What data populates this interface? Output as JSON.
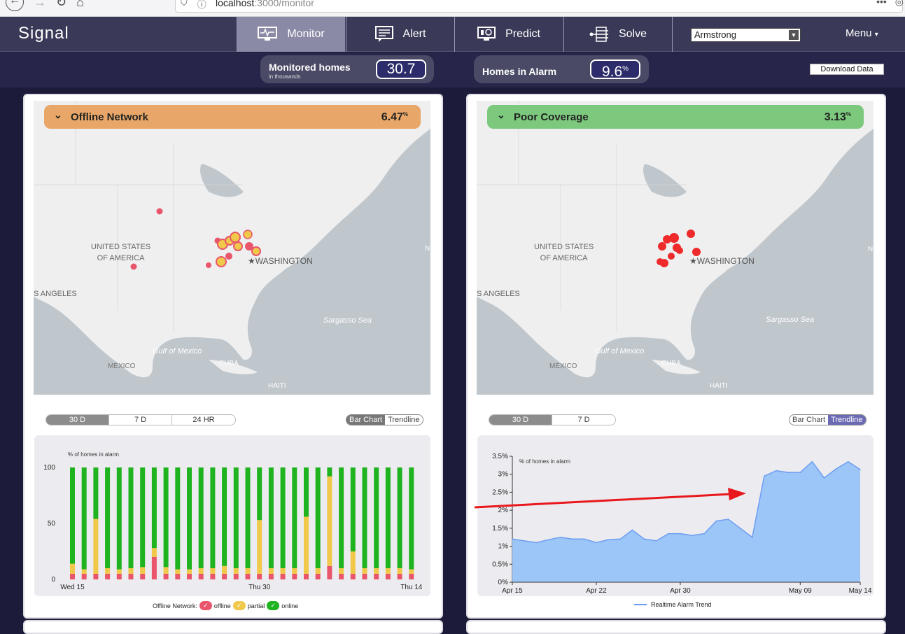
{
  "browser": {
    "url_host": "localhost",
    "url_path": ":3000/monitor"
  },
  "app": {
    "title": "Signal"
  },
  "nav": {
    "tabs": [
      {
        "label": "Monitor",
        "icon": "monitor-icon",
        "active": true
      },
      {
        "label": "Alert",
        "icon": "alert-icon",
        "active": false
      },
      {
        "label": "Predict",
        "icon": "predict-icon",
        "active": false
      },
      {
        "label": "Solve",
        "icon": "solve-icon",
        "active": false
      }
    ],
    "select_value": "Armstrong",
    "menu_label": "Menu"
  },
  "stats": {
    "monitored_label": "Monitored homes",
    "monitored_sub": "in thousands",
    "monitored_value": "30.7",
    "alarm_label": "Homes in Alarm",
    "alarm_value": "9.6",
    "alarm_unit": "%",
    "download_label": "Download Data"
  },
  "colors": {
    "offline_banner": "#e8a768",
    "coverage_banner": "#7cc97e",
    "bar_online": "#1fb31f",
    "bar_partial": "#f0c84a",
    "bar_offline": "#e9566b",
    "trend_fill": "#9cc6f7",
    "trend_line": "#6d9df2",
    "annotation_arrow": "#e8181c"
  },
  "map_labels": {
    "us": [
      "UNITED STATES",
      "OF AMERICA"
    ],
    "washington": "WASHINGTON",
    "los_angeles": "S ANGELES",
    "sargasso": "Sargasso Sea",
    "gulf": "Gulf of Mexico",
    "mexico": "MÉXICO",
    "cuba": "CUBA",
    "haiti": "HAITI",
    "edge": "N"
  },
  "card_offline": {
    "title": "Offline Network",
    "percent": "6.47",
    "unit": "%",
    "ranges": [
      "30 D",
      "7 D",
      "24 HR"
    ],
    "active_range": "30 D",
    "types": [
      "Bar Chart",
      "Trendline"
    ],
    "active_type": "Bar Chart",
    "legend_title": "Offline Network:",
    "legend": [
      "offline",
      "partial",
      "online"
    ]
  },
  "card_coverage": {
    "title": "Poor Coverage",
    "percent": "3.13",
    "unit": "%",
    "ranges": [
      "30 D",
      "7 D"
    ],
    "active_range": "30 D",
    "types": [
      "Bar Chart",
      "Trendline"
    ],
    "active_type": "Trendline",
    "legend": [
      "Realtime Alarm Trend"
    ]
  },
  "chart_data": [
    {
      "type": "bar",
      "stacked": true,
      "ylabel": "% of homes in alarm",
      "ylim": [
        0,
        100
      ],
      "yticks": [
        0,
        50,
        100
      ],
      "xtick_labels": [
        "Wed 15",
        "Thu 30",
        "Thu 14"
      ],
      "series": [
        {
          "name": "offline",
          "values": [
            5,
            5,
            5,
            5,
            5,
            5,
            5,
            20,
            5,
            5,
            5,
            5,
            5,
            5,
            5,
            5,
            5,
            5,
            5,
            5,
            5,
            5,
            12,
            5,
            5,
            5,
            5,
            5,
            5,
            5
          ]
        },
        {
          "name": "partial",
          "values": [
            9,
            4,
            49,
            5,
            4,
            5,
            6,
            8,
            6,
            4,
            4,
            5,
            5,
            7,
            5,
            5,
            48,
            5,
            5,
            5,
            51,
            5,
            80,
            5,
            20,
            5,
            5,
            5,
            5,
            4
          ]
        },
        {
          "name": "online",
          "values": [
            86,
            91,
            46,
            90,
            91,
            90,
            89,
            72,
            89,
            91,
            91,
            90,
            90,
            88,
            90,
            90,
            47,
            90,
            90,
            90,
            44,
            90,
            8,
            90,
            75,
            90,
            90,
            90,
            90,
            91
          ]
        }
      ]
    },
    {
      "type": "area",
      "ylabel": "% of homes in alarm",
      "ylim": [
        0,
        3.5
      ],
      "yticks": [
        "0%",
        "0.5%",
        "1%",
        "1.5%",
        "2%",
        "2.5%",
        "3%",
        "3.5%"
      ],
      "xtick_labels": [
        "Apr 15",
        "Apr 22",
        "Apr 30",
        "May 09",
        "May 14"
      ],
      "series": [
        {
          "name": "Realtime Alarm Trend",
          "values": [
            1.2,
            1.15,
            1.1,
            1.18,
            1.25,
            1.2,
            1.2,
            1.1,
            1.18,
            1.2,
            1.45,
            1.2,
            1.15,
            1.35,
            1.35,
            1.3,
            1.35,
            1.7,
            1.75,
            1.5,
            1.25,
            2.95,
            3.1,
            3.05,
            3.05,
            3.35,
            2.9,
            3.15,
            3.35,
            3.13
          ]
        }
      ]
    }
  ]
}
